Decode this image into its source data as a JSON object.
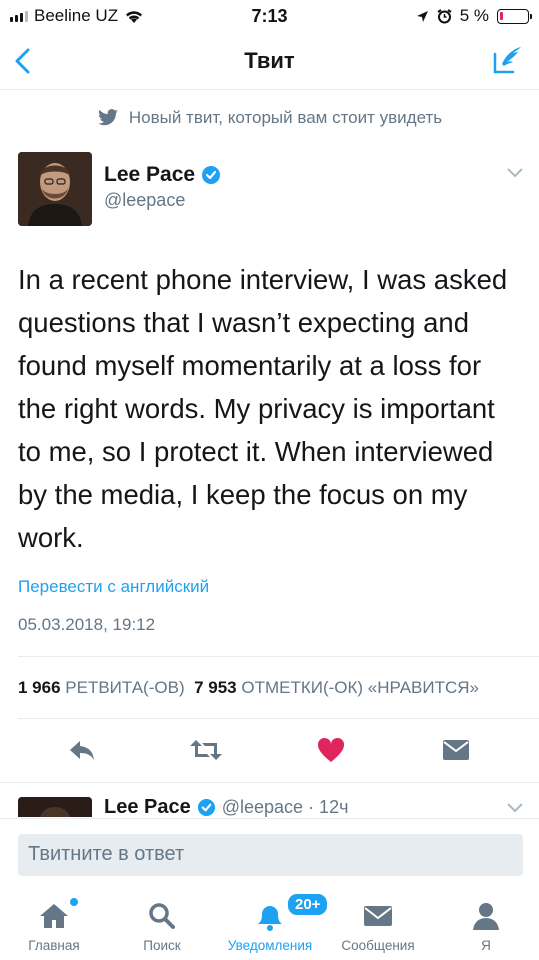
{
  "status_bar": {
    "carrier": "Beeline UZ",
    "time": "7:13",
    "battery": "5 %"
  },
  "nav": {
    "title": "Твит"
  },
  "context": {
    "text": "Новый твит, который вам стоит увидеть"
  },
  "tweet": {
    "name": "Lee Pace",
    "handle": "@leepace",
    "text": "In a recent phone interview, I was asked questions that I wasn’t expecting and found myself momentarily at a loss for the right words. My privacy is important to me, so I protect it. When interviewed by the media, I keep the focus on my work.",
    "translate": "Перевести с английский",
    "date": "05.03.2018, 19:12",
    "retweets_count": "1 966",
    "retweets_label": "РЕТВИТА(-ОВ)",
    "likes_count": "7 953",
    "likes_label": "ОТМЕТКИ(-ОК) «НРАВИТСЯ»"
  },
  "next_tweet": {
    "name": "Lee Pace",
    "meta": "@leepace · 12ч"
  },
  "reply": {
    "placeholder": "Твитните в ответ"
  },
  "tabs": [
    {
      "label": "Главная"
    },
    {
      "label": "Поиск"
    },
    {
      "label": "Уведомления",
      "badge": "20+"
    },
    {
      "label": "Сообщения"
    },
    {
      "label": "Я"
    }
  ],
  "colors": {
    "accent": "#1da1f2",
    "like": "#e0245e",
    "muted": "#657786"
  }
}
